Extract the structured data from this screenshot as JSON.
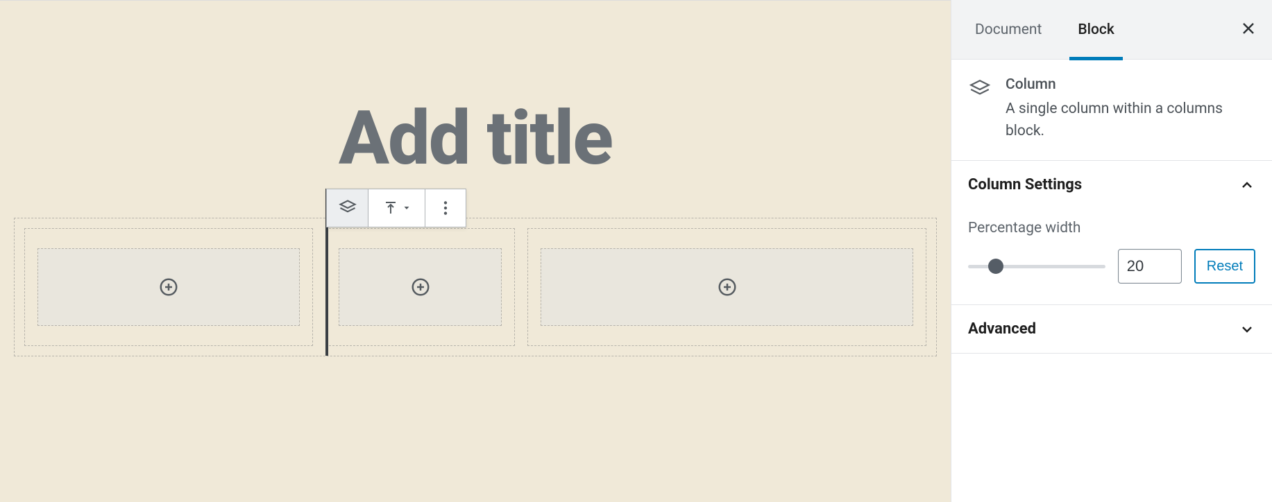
{
  "editor": {
    "title_placeholder": "Add title"
  },
  "sidebar": {
    "tabs": {
      "document": "Document",
      "block": "Block"
    },
    "block": {
      "name": "Column",
      "description": "A single column within a columns block."
    },
    "panels": {
      "column_settings": {
        "title": "Column Settings",
        "percentage_label": "Percentage width",
        "percentage_value": "20",
        "reset_label": "Reset"
      },
      "advanced": {
        "title": "Advanced"
      }
    }
  }
}
